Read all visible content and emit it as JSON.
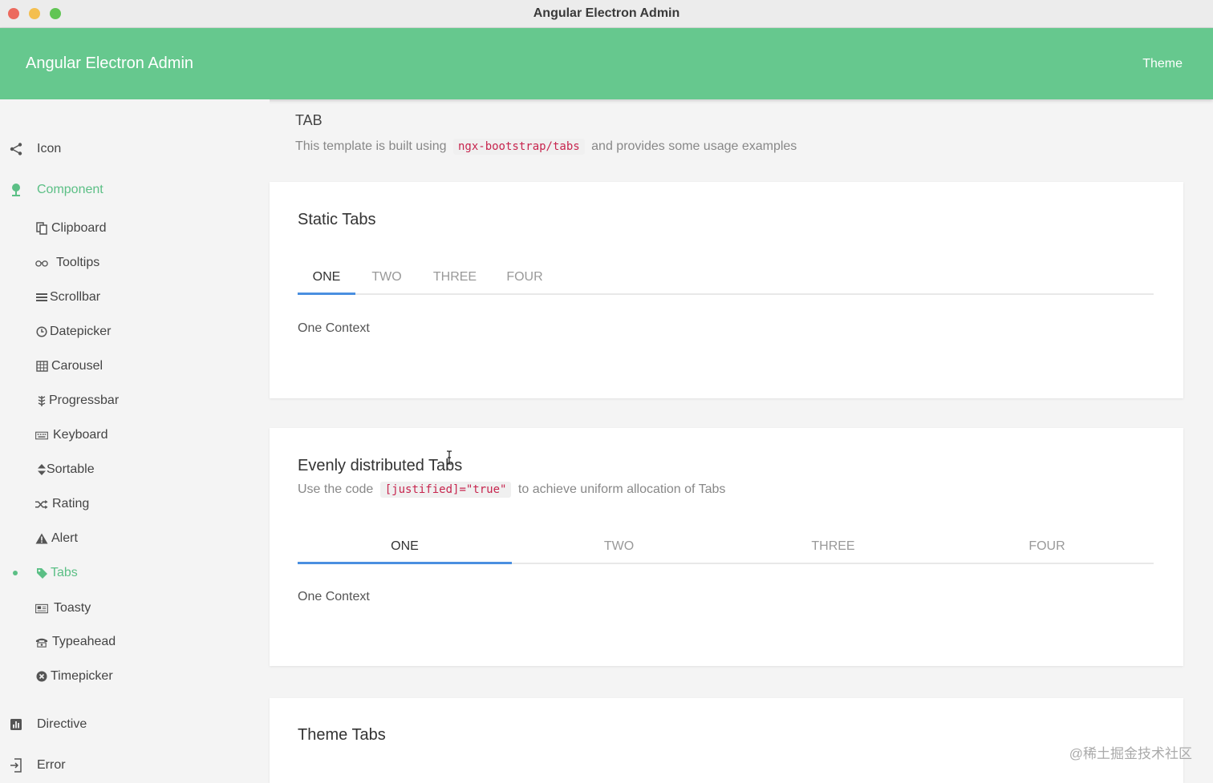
{
  "window": {
    "title": "Angular Electron Admin"
  },
  "appbar": {
    "title": "Angular Electron Admin",
    "theme_label": "Theme"
  },
  "sidebar": {
    "top_items": [
      {
        "label": "Icon"
      },
      {
        "label": "Component"
      }
    ],
    "component_items": [
      {
        "label": "Clipboard"
      },
      {
        "label": "Tooltips"
      },
      {
        "label": "Scrollbar"
      },
      {
        "label": "Datepicker"
      },
      {
        "label": "Carousel"
      },
      {
        "label": "Progressbar"
      },
      {
        "label": "Keyboard"
      },
      {
        "label": "Sortable"
      },
      {
        "label": "Rating"
      },
      {
        "label": "Alert"
      },
      {
        "label": "Tabs"
      },
      {
        "label": "Toasty"
      },
      {
        "label": "Typeahead"
      },
      {
        "label": "Timepicker"
      }
    ],
    "bottom_items": [
      {
        "label": "Directive"
      },
      {
        "label": "Error"
      }
    ]
  },
  "page": {
    "title": "TAB",
    "desc_before": "This template is built using",
    "desc_code": "ngx-bootstrap/tabs",
    "desc_after": "and provides some usage examples"
  },
  "static_tabs": {
    "title": "Static Tabs",
    "tabs": [
      "ONE",
      "TWO",
      "THREE",
      "FOUR"
    ],
    "content": "One Context"
  },
  "justified_tabs": {
    "title": "Evenly distributed Tabs",
    "desc_before": "Use the code",
    "desc_code": "[justified]=\"true\"",
    "desc_after": "to achieve uniform allocation of Tabs",
    "tabs": [
      "ONE",
      "TWO",
      "THREE",
      "FOUR"
    ],
    "content": "One Context"
  },
  "theme_tabs": {
    "title": "Theme Tabs"
  },
  "watermark": "@稀土掘金技术社区",
  "colors": {
    "accent": "#66c88e",
    "active": "#5bbf85",
    "ink": "#4a8fe0"
  }
}
